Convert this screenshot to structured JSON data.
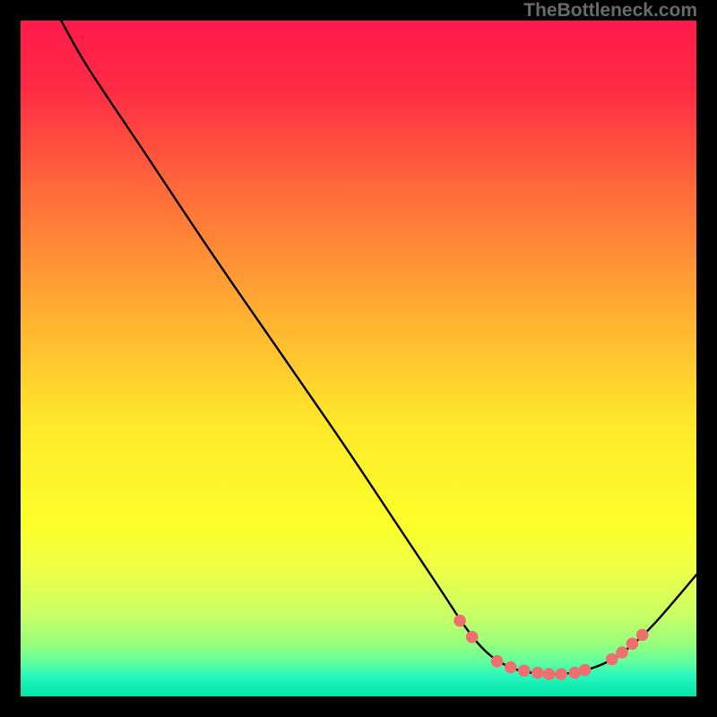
{
  "watermark": "TheBottleneck.com",
  "chart_data": {
    "type": "line",
    "title": "",
    "xlabel": "",
    "ylabel": "",
    "xlim": [
      0,
      100
    ],
    "ylim": [
      0,
      100
    ],
    "gradient_stops": [
      {
        "offset": 0,
        "color": "#ff1a4b"
      },
      {
        "offset": 10,
        "color": "#ff2b45"
      },
      {
        "offset": 25,
        "color": "#ff6a3a"
      },
      {
        "offset": 45,
        "color": "#ffb530"
      },
      {
        "offset": 60,
        "color": "#ffe92a"
      },
      {
        "offset": 75,
        "color": "#fbff2a"
      },
      {
        "offset": 82,
        "color": "#eaff4a"
      },
      {
        "offset": 88,
        "color": "#c8ff66"
      },
      {
        "offset": 92,
        "color": "#9aff7a"
      },
      {
        "offset": 95,
        "color": "#5effa0"
      },
      {
        "offset": 97,
        "color": "#27f7bd"
      },
      {
        "offset": 100,
        "color": "#00e6a8"
      }
    ],
    "series": [
      {
        "name": "bottleneck-curve",
        "type": "line",
        "color": "#000000",
        "points": [
          {
            "x": 6.0,
            "y": 100.0
          },
          {
            "x": 10.0,
            "y": 93.0
          },
          {
            "x": 18.0,
            "y": 81.0
          },
          {
            "x": 28.0,
            "y": 66.0
          },
          {
            "x": 38.0,
            "y": 51.5
          },
          {
            "x": 48.0,
            "y": 37.0
          },
          {
            "x": 56.0,
            "y": 25.0
          },
          {
            "x": 62.0,
            "y": 16.0
          },
          {
            "x": 66.0,
            "y": 10.0
          },
          {
            "x": 69.0,
            "y": 6.5
          },
          {
            "x": 72.0,
            "y": 4.5
          },
          {
            "x": 75.0,
            "y": 3.6
          },
          {
            "x": 78.0,
            "y": 3.3
          },
          {
            "x": 81.0,
            "y": 3.4
          },
          {
            "x": 84.0,
            "y": 4.0
          },
          {
            "x": 87.0,
            "y": 5.2
          },
          {
            "x": 90.0,
            "y": 7.2
          },
          {
            "x": 94.0,
            "y": 11.0
          },
          {
            "x": 100.0,
            "y": 18.0
          }
        ]
      },
      {
        "name": "highlight-dots",
        "type": "scatter",
        "color": "#ef6f6f",
        "radius_pct": 0.9,
        "points": [
          {
            "x": 65.0,
            "y": 11.2
          },
          {
            "x": 66.8,
            "y": 8.8
          },
          {
            "x": 70.5,
            "y": 5.2
          },
          {
            "x": 72.5,
            "y": 4.3
          },
          {
            "x": 74.5,
            "y": 3.8
          },
          {
            "x": 76.5,
            "y": 3.5
          },
          {
            "x": 78.2,
            "y": 3.3
          },
          {
            "x": 80.0,
            "y": 3.3
          },
          {
            "x": 82.0,
            "y": 3.5
          },
          {
            "x": 83.5,
            "y": 3.9
          },
          {
            "x": 87.5,
            "y": 5.5
          },
          {
            "x": 89.0,
            "y": 6.5
          },
          {
            "x": 90.5,
            "y": 7.8
          },
          {
            "x": 92.0,
            "y": 9.1
          }
        ]
      }
    ]
  }
}
